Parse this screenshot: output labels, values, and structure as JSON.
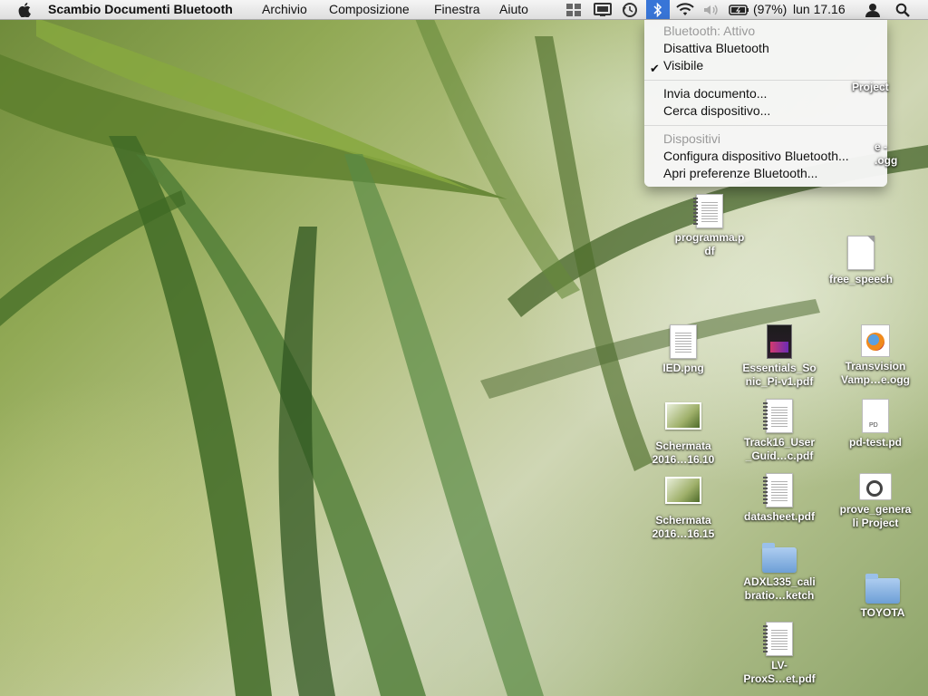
{
  "menubar": {
    "apple_icon": "",
    "app_name": "Scambio Documenti Bluetooth",
    "menus": [
      "Archivio",
      "Composizione",
      "Finestra",
      "Aiuto"
    ],
    "battery": "(97%)",
    "clock": "lun 17.16"
  },
  "bluetooth_menu": {
    "status": "Bluetooth: Attivo",
    "toggle": "Disattiva Bluetooth",
    "visible": "Visibile",
    "send_file": "Invia documento...",
    "browse_device": "Cerca dispositivo...",
    "devices_header": "Dispositivi",
    "setup_device": "Configura dispositivo Bluetooth...",
    "open_prefs": "Apri preferenze Bluetooth..."
  },
  "desktop_icons": {
    "partial_1": "Project",
    "partial_2a": "e -",
    "partial_2b": ".ogg",
    "programma_1": "programma.p",
    "programma_2": "df",
    "free_speech": "free_speech",
    "ied": "IED.png",
    "essentials_1": "Essentials_So",
    "essentials_2": "nic_Pi-v1.pdf",
    "transvision_1": "Transvision",
    "transvision_2": "Vamp…e.ogg",
    "schermata10_1": "Schermata",
    "schermata10_2": "2016…16.10",
    "track16_1": "Track16_User",
    "track16_2": "_Guid…c.pdf",
    "pdtest": "pd-test.pd",
    "schermata15_1": "Schermata",
    "schermata15_2": "2016…16.15",
    "datasheet": "datasheet.pdf",
    "prove_1": "prove_genera",
    "prove_2": "li Project",
    "adxl_1": "ADXL335_cali",
    "adxl_2": "bratio…ketch",
    "toyota": "TOYOTA",
    "lv_1": "LV-",
    "lv_2": "ProxS…et.pdf",
    "pd_badge": "PD"
  }
}
